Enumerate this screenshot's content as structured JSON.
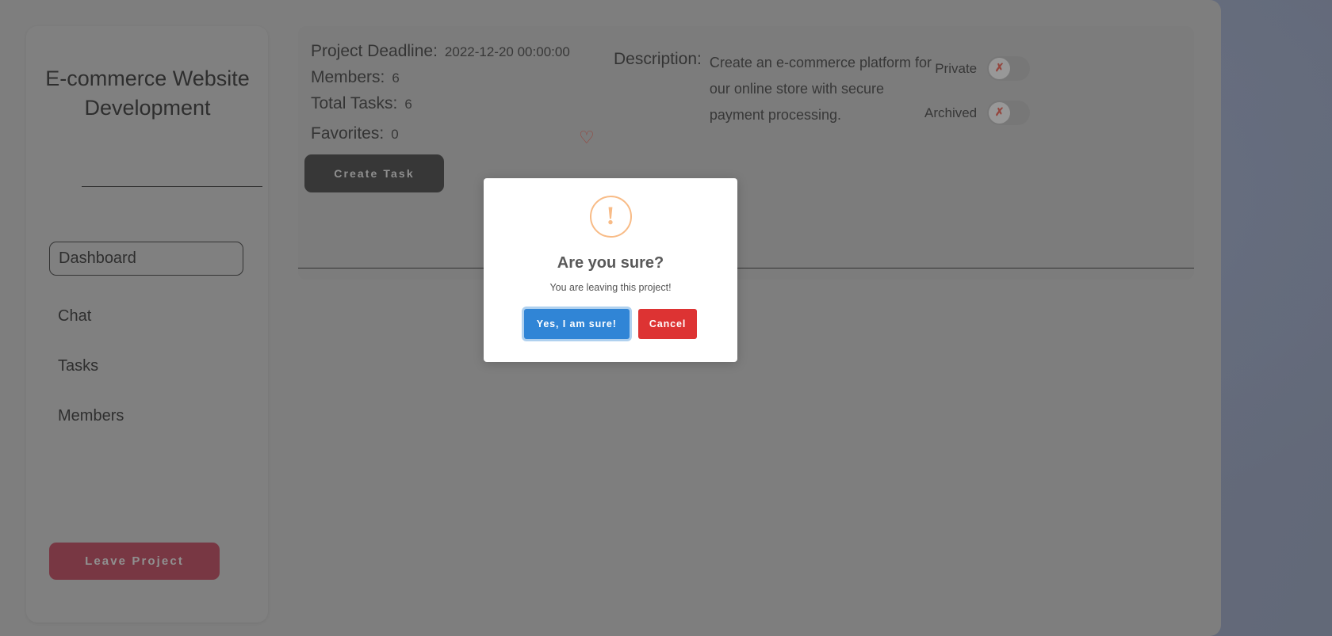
{
  "sidebar": {
    "project_title": "E-commerce Website Development",
    "nav_items": [
      {
        "label": "Dashboard",
        "active": true
      },
      {
        "label": "Chat",
        "active": false
      },
      {
        "label": "Tasks",
        "active": false
      },
      {
        "label": "Members",
        "active": false
      }
    ],
    "leave_button_label": "Leave Project"
  },
  "content": {
    "info": [
      {
        "label": "Project Deadline:",
        "value": "2022-12-20 00:00:00"
      },
      {
        "label": "Members:",
        "value": "6"
      },
      {
        "label": "Total Tasks:",
        "value": "6"
      },
      {
        "label": "Favorites:",
        "value": "0"
      }
    ],
    "favorite_icon": "heart-outline-icon",
    "favorite_icon_glyph": "♡",
    "favorite_color": "#c0392b",
    "create_task_label": "Create Task",
    "description_label": "Description:",
    "description_text": "Create an e-commerce platform for our online store with secure payment processing.",
    "toggles": [
      {
        "label": "Private",
        "state": "off",
        "knob_glyph": "✗"
      },
      {
        "label": "Archived",
        "state": "off",
        "knob_glyph": "✗"
      }
    ]
  },
  "modal": {
    "icon": "warning-exclamation-icon",
    "icon_glyph": "!",
    "icon_color": "#f8bb86",
    "title": "Are you sure?",
    "message": "You are leaving this project!",
    "confirm_label": "Yes, I am sure!",
    "cancel_label": "Cancel",
    "confirm_color": "#3085d6",
    "cancel_color": "#dd3333"
  }
}
